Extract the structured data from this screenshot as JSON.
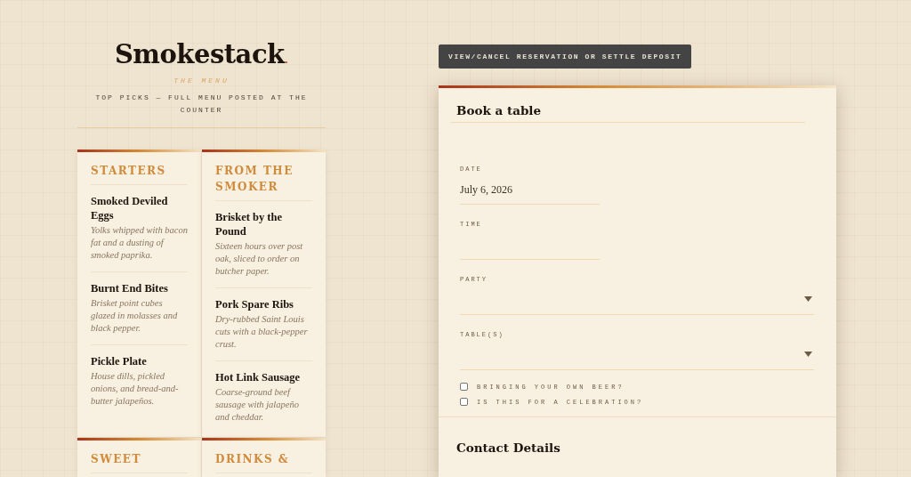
{
  "brand": {
    "name": "Smokestack",
    "dot": ".",
    "subtitle": "THE MENU",
    "tagline": "TOP PICKS — FULL MENU POSTED AT THE COUNTER"
  },
  "menu": [
    {
      "title": "STARTERS",
      "items": [
        {
          "name": "Smoked Deviled Eggs",
          "desc": "Yolks whipped with bacon fat and a dusting of smoked paprika."
        },
        {
          "name": "Burnt End Bites",
          "desc": "Brisket point cubes glazed in molasses and black pepper."
        },
        {
          "name": "Pickle Plate",
          "desc": "House dills, pickled onions, and bread-and-butter jalapeños."
        }
      ]
    },
    {
      "title": "FROM THE SMOKER",
      "items": [
        {
          "name": "Brisket by the Pound",
          "desc": "Sixteen hours over post oak, sliced to order on butcher paper."
        },
        {
          "name": "Pork Spare Ribs",
          "desc": "Dry-rubbed Saint Louis cuts with a black-pepper crust."
        },
        {
          "name": "Hot Link Sausage",
          "desc": "Coarse-ground beef sausage with jalapeño and cheddar."
        }
      ]
    },
    {
      "title": "SWEET"
    },
    {
      "title": "DRINKS &"
    }
  ],
  "manage_button": "VIEW/CANCEL RESERVATION OR SETTLE DEPOSIT",
  "booking": {
    "title": "Book a table",
    "fields": [
      {
        "kind": "text",
        "label": "DATE",
        "value": "July 6, 2026"
      },
      {
        "kind": "text",
        "label": "TIME"
      },
      {
        "kind": "select",
        "label": "PARTY"
      },
      {
        "kind": "select",
        "label": "TABLE(S)"
      }
    ],
    "checkboxes": [
      {
        "label": "BRINGING YOUR OWN BEER?",
        "checked": false
      },
      {
        "label": "IS THIS FOR A CELEBRATION?",
        "checked": false
      }
    ]
  },
  "contact": {
    "title": "Contact Details"
  }
}
